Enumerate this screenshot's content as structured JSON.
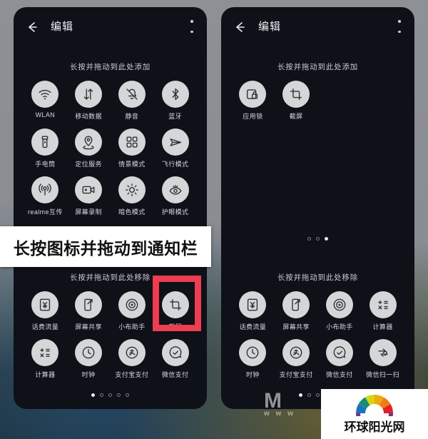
{
  "header": {
    "title": "编辑",
    "back_icon": "arrow-left-icon",
    "menu_icon": "more-vertical-icon"
  },
  "left_panel": {
    "add_hint": "长按并拖动到此处添加",
    "remove_hint": "长按并拖动到此处移除",
    "add_tiles": [
      {
        "label": "WLAN",
        "icon": "wifi-icon"
      },
      {
        "label": "移动数据",
        "icon": "mobile-data-icon"
      },
      {
        "label": "静音",
        "icon": "bell-mute-icon"
      },
      {
        "label": "蓝牙",
        "icon": "bluetooth-icon"
      },
      {
        "label": "手电筒",
        "icon": "flashlight-icon"
      },
      {
        "label": "定位服务",
        "icon": "location-icon"
      },
      {
        "label": "情景模式",
        "icon": "scene-mode-icon"
      },
      {
        "label": "飞行模式",
        "icon": "airplane-icon"
      },
      {
        "label": "realme互传",
        "icon": "share-broadcast-icon"
      },
      {
        "label": "屏幕录制",
        "icon": "screen-record-icon"
      },
      {
        "label": "暗色模式",
        "icon": "brightness-icon"
      },
      {
        "label": "护眼模式",
        "icon": "eye-care-icon"
      }
    ],
    "active_tiles": [
      {
        "label": "话费流量",
        "icon": "yuan-data-icon"
      },
      {
        "label": "屏幕共享",
        "icon": "screen-share-icon"
      },
      {
        "label": "小布助手",
        "icon": "assistant-icon"
      },
      {
        "label": "截屏",
        "icon": "screenshot-icon",
        "highlighted": true
      },
      {
        "label": "计算器",
        "icon": "calculator-icon"
      },
      {
        "label": "时钟",
        "icon": "clock-icon"
      },
      {
        "label": "支付宝支付",
        "icon": "alipay-pay-icon"
      },
      {
        "label": "微信支付",
        "icon": "wechat-pay-icon"
      }
    ],
    "page_dots": {
      "count": 5,
      "active_index": 0
    }
  },
  "right_panel": {
    "add_hint": "长按并拖动到此处添加",
    "remove_hint": "长按并拖动到此处移除",
    "add_tiles": [
      {
        "label": "应用锁",
        "icon": "app-lock-icon"
      },
      {
        "label": "截屏",
        "icon": "screenshot-icon"
      }
    ],
    "active_tiles": [
      {
        "label": "话费流量",
        "icon": "yuan-data-icon"
      },
      {
        "label": "屏幕共享",
        "icon": "screen-share-icon"
      },
      {
        "label": "小布助手",
        "icon": "assistant-icon"
      },
      {
        "label": "计算器",
        "icon": "calculator-icon"
      },
      {
        "label": "时钟",
        "icon": "clock-icon"
      },
      {
        "label": "支付宝支付",
        "icon": "alipay-pay-icon"
      },
      {
        "label": "微信支付",
        "icon": "wechat-pay-icon"
      },
      {
        "label": "微信扫一扫",
        "icon": "wechat-scan-icon"
      }
    ],
    "add_page_dots": {
      "count": 3,
      "active_index": 2
    },
    "page_dots": {
      "count": 5,
      "active_index": 0
    }
  },
  "caption_banner": {
    "text": "长按图标并拖动到通知栏"
  },
  "watermark": {
    "mark": "M",
    "sub": "w w w"
  },
  "logo": {
    "text": "环球阳光网",
    "icon": "rainbow-fan-icon",
    "colors": [
      "#168d7a",
      "#2e8f5e",
      "#d8d412",
      "#f0a80d",
      "#ef7d15",
      "#e02027",
      "#7b2d94",
      "#1a74bd"
    ]
  },
  "colors": {
    "screen_bg": "#0e1118",
    "tile_bubble": "#d4d6d8",
    "highlight_red": "#ee3c50",
    "text_light": "#d5d8dd"
  }
}
